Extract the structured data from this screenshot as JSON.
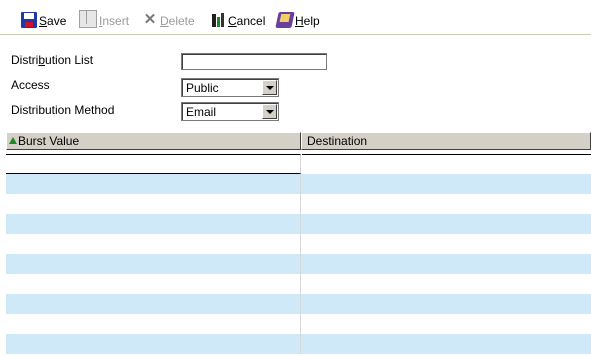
{
  "toolbar": {
    "save": "Save",
    "insert": "Insert",
    "delete": "Delete",
    "cancel": "Cancel",
    "help": "Help"
  },
  "form": {
    "distribution_list_label": "Distribution List",
    "distribution_list_value": "",
    "access_label": "Access",
    "access_value": "Public",
    "method_label": "Distribution Method",
    "method_value": "Email"
  },
  "grid": {
    "columns": [
      "Burst Value",
      "Destination"
    ],
    "sort_column": "Burst Value",
    "rows": [
      [
        "",
        ""
      ],
      [
        "",
        ""
      ],
      [
        "",
        ""
      ],
      [
        "",
        ""
      ],
      [
        "",
        ""
      ],
      [
        "",
        ""
      ],
      [
        "",
        ""
      ],
      [
        "",
        ""
      ],
      [
        "",
        ""
      ],
      [
        "",
        ""
      ]
    ]
  },
  "colors": {
    "alt_row": "#cfe9f8",
    "header_bg": "#d4d0c8",
    "sort_icon": "#1e8a1e"
  }
}
